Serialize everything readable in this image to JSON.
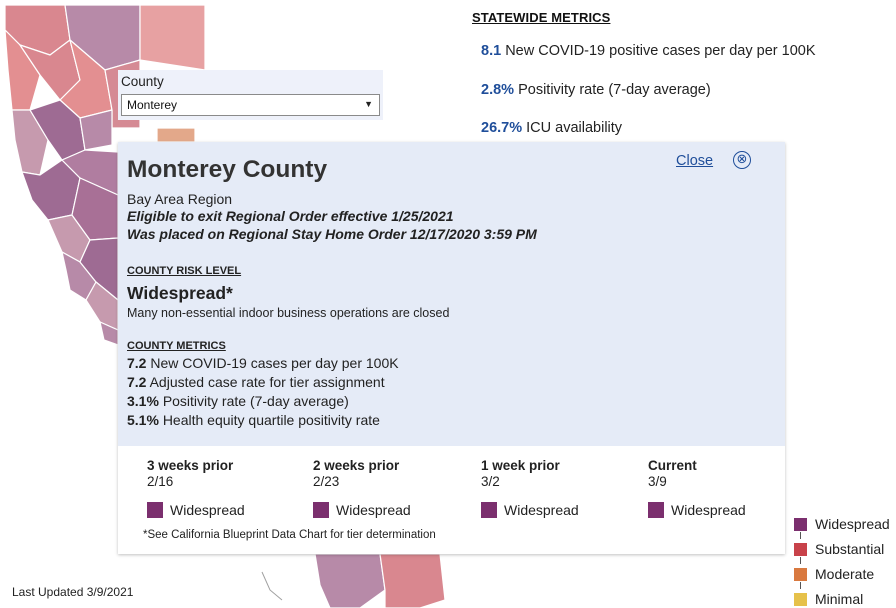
{
  "statewide": {
    "heading": "STATEWIDE METRICS",
    "metrics": [
      {
        "value": "8.1",
        "label": "New COVID-19 positive cases per day per 100K"
      },
      {
        "value": "2.8%",
        "label": "Positivity rate (7-day average)"
      },
      {
        "value": "26.7%",
        "label": "ICU availability"
      }
    ]
  },
  "county_select": {
    "label": "County",
    "selected": "Monterey",
    "caret": "▼"
  },
  "popup": {
    "title": "Monterey County",
    "region": "Bay Area Region",
    "exit_note": "Eligible to exit Regional Order effective 1/25/2021",
    "order_note": "Was placed on Regional Stay Home Order 12/17/2020 3:59 PM",
    "close_label": "Close",
    "close_icon": "⊗",
    "risk_heading": "COUNTY RISK LEVEL",
    "risk_level": "Widespread*",
    "risk_desc": "Many non-essential indoor business operations are closed",
    "metrics_heading": "COUNTY METRICS",
    "metrics": [
      {
        "value": "7.2",
        "label": "New COVID-19 cases per day per 100K"
      },
      {
        "value": "7.2",
        "label": "Adjusted case rate for tier assignment"
      },
      {
        "value": "3.1%",
        "label": "Positivity rate (7-day average)"
      },
      {
        "value": "5.1%",
        "label": "Health equity quartile positivity rate"
      }
    ],
    "timeline": [
      {
        "title": "3 weeks prior",
        "date": "2/16",
        "tier": "Widespread"
      },
      {
        "title": "2 weeks prior",
        "date": "2/23",
        "tier": "Widespread"
      },
      {
        "title": "1 week prior",
        "date": "3/2",
        "tier": "Widespread"
      },
      {
        "title": "Current",
        "date": "3/9",
        "tier": "Widespread"
      }
    ],
    "footnote": "*See California Blueprint Data Chart for tier determination"
  },
  "legend": [
    {
      "label": "Widespread",
      "color": "#7b2f6e"
    },
    {
      "label": "Substantial",
      "color": "#c8424a"
    },
    {
      "label": "Moderate",
      "color": "#d9793f"
    },
    {
      "label": "Minimal",
      "color": "#e6c14a"
    }
  ],
  "last_updated": "Last Updated 3/9/2021"
}
